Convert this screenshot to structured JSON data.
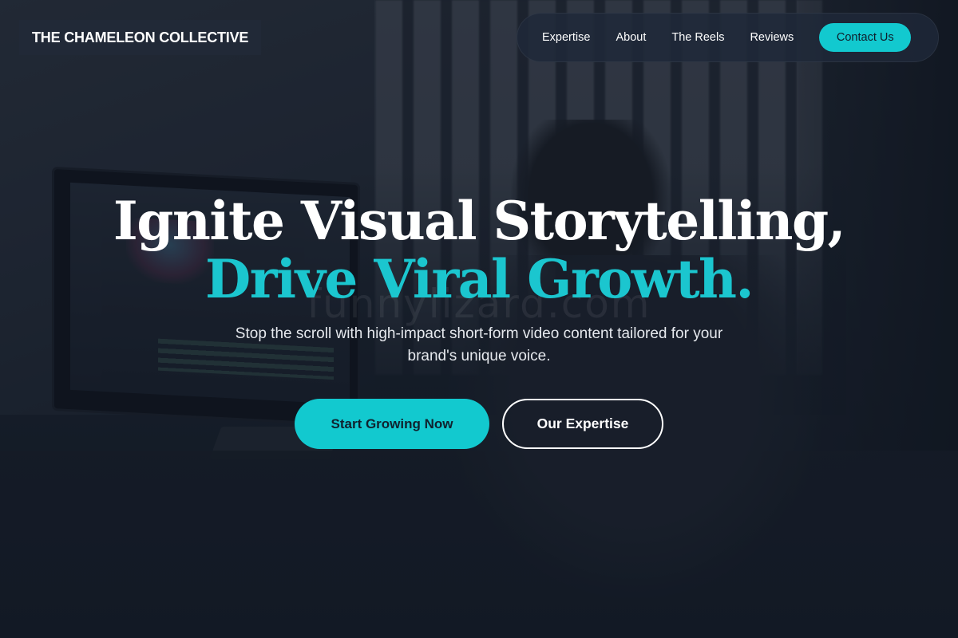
{
  "brand": {
    "name": "THE CHAMELEON COLLECTIVE"
  },
  "nav": {
    "items": [
      {
        "label": "Expertise"
      },
      {
        "label": "About"
      },
      {
        "label": "The Reels"
      },
      {
        "label": "Reviews"
      }
    ],
    "cta_label": "Contact Us"
  },
  "hero": {
    "title_line1": "Ignite Visual Storytelling,",
    "title_line2": "Drive Viral Growth.",
    "subtitle": "Stop the scroll with high-impact short-form video content tailored for your brand's unique voice.",
    "primary_button": "Start Growing Now",
    "secondary_button": "Our Expertise"
  },
  "watermark": "funnylizard.com",
  "colors": {
    "accent": "#12c9cf",
    "background": "#141c28",
    "nav_background": "#1e2838"
  }
}
